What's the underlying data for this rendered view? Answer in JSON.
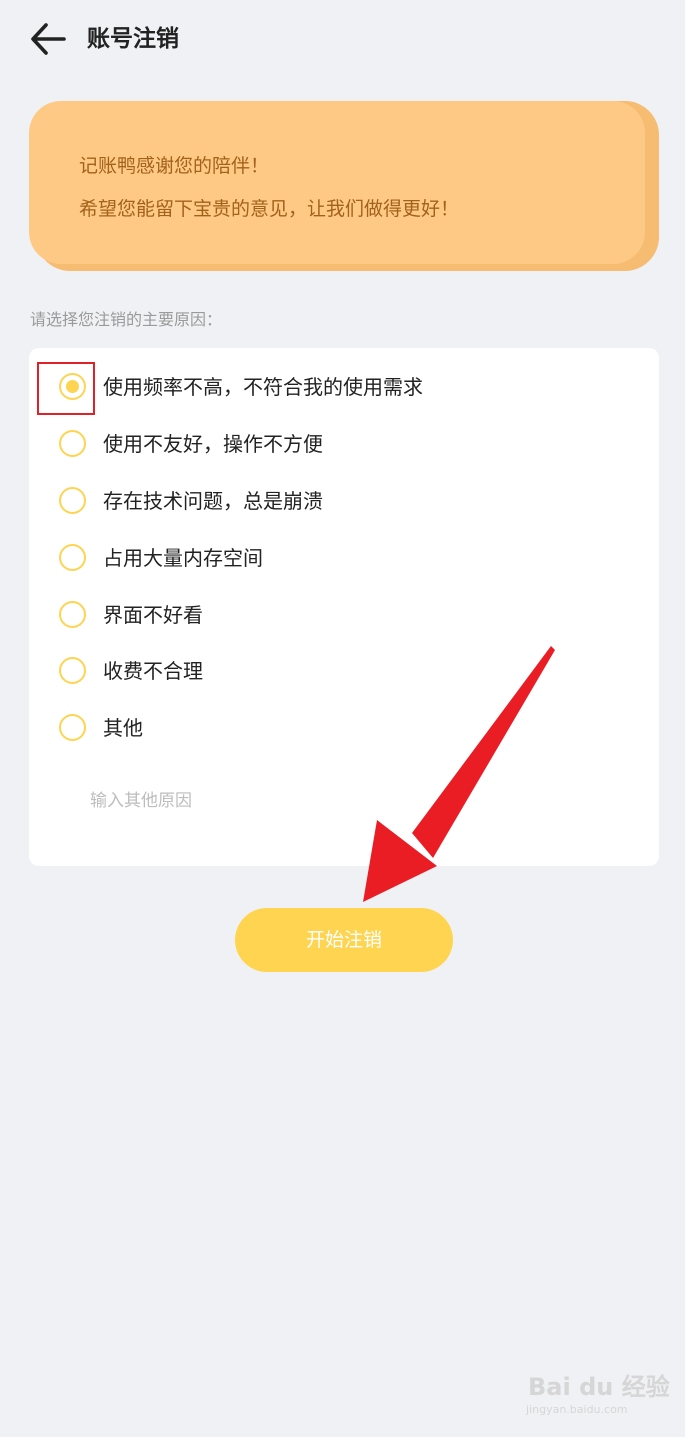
{
  "header": {
    "title": "账号注销",
    "back_icon": "arrow-left-icon"
  },
  "banner": {
    "line1": "记账鸭感谢您的陪伴！",
    "line2": "希望您能留下宝贵的意见，让我们做得更好！",
    "bg_color": "#fec984",
    "text_color": "#a3621c"
  },
  "reasons": {
    "label": "请选择您注销的主要原因：",
    "selected_index": 0,
    "options": [
      "使用频率不高，不符合我的使用需求",
      "使用不友好，操作不方便",
      "存在技术问题，总是崩溃",
      "占用大量内存空间",
      "界面不好看",
      "收费不合理",
      "其他"
    ],
    "other_placeholder": "输入其他原因",
    "accent_color": "#fed451"
  },
  "actions": {
    "start_label": "开始注销",
    "button_color": "#fed451"
  },
  "annotation": {
    "highlight_color": "#e0212a",
    "arrow_color": "#ea1c24"
  },
  "watermark": {
    "brand": "Bai du 经验",
    "url": "jingyan.baidu.com"
  }
}
